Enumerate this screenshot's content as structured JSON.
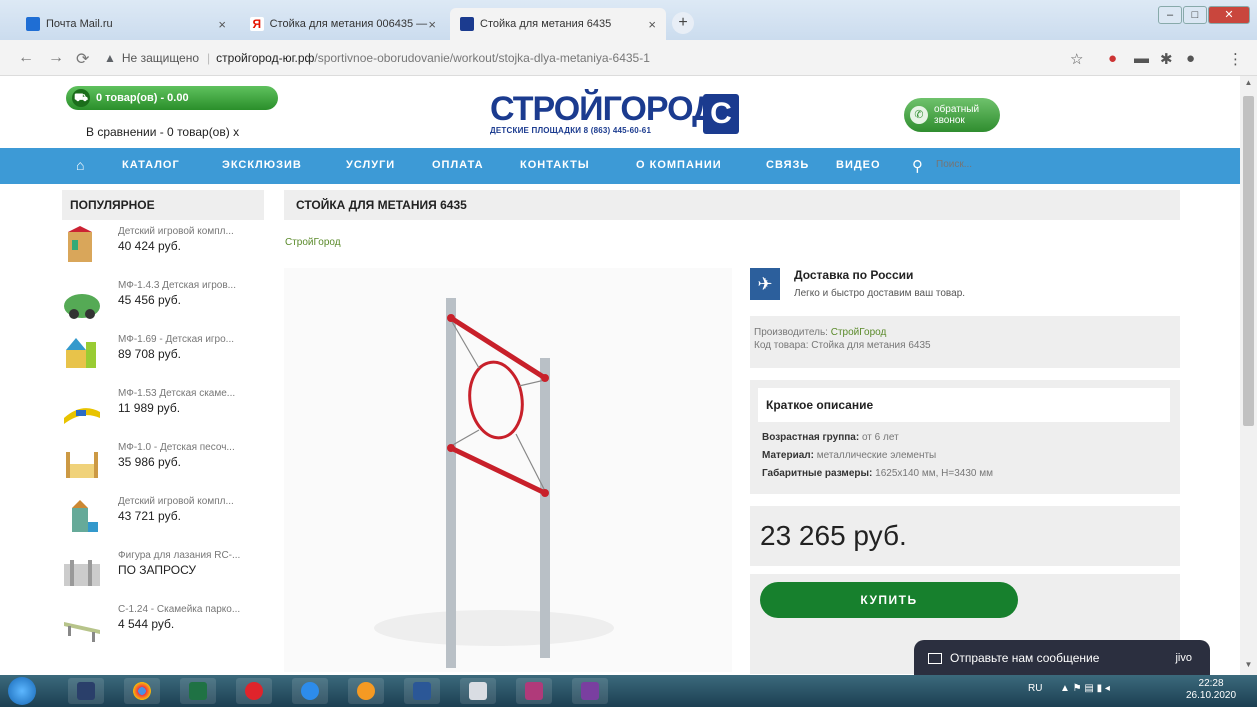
{
  "browser": {
    "tabs": [
      {
        "label": "Почта Mail.ru",
        "close": "×",
        "active": false
      },
      {
        "label": "Стойка для метания 006435 — :",
        "close": "×",
        "active": false
      },
      {
        "label": "Стойка для метания 6435",
        "close": "×",
        "active": true
      }
    ],
    "new_tab": "+",
    "security_label": "Не защищено",
    "url_host": "стройгород-юг.рф",
    "url_path": "/sportivnoe-oborudovanie/workout/stojka-dlya-metaniya-6435-1"
  },
  "header": {
    "cart_label": "0 товар(ов) - 0.00",
    "compare_label": "В сравнении - 0 товар(ов) x",
    "logo_text": "СТРОЙГОРОД",
    "logo_sub": "ДЕТСКИЕ ПЛОЩАДКИ 8 (863) 445-60-61",
    "callback_label_1": "обратный",
    "callback_label_2": "звонок"
  },
  "menu": {
    "items": [
      "КАТАЛОГ",
      "ЭКСКЛЮЗИВ",
      "УСЛУГИ",
      "ОПЛАТА",
      "КОНТАКТЫ",
      "О КОМПАНИИ",
      "СВЯЗЬ",
      "ВИДЕО"
    ],
    "search_placeholder": "Поиск..."
  },
  "sidebar": {
    "title": "ПОПУЛЯРНОЕ",
    "items": [
      {
        "name": "Детский игровой компл...",
        "price": "40 424 руб."
      },
      {
        "name": "МФ-1.4.3 Детская игров...",
        "price": "45 456 руб."
      },
      {
        "name": "МФ-1.69 - Детская игро...",
        "price": "89 708 руб."
      },
      {
        "name": "МФ-1.53 Детская скаме...",
        "price": "11 989 руб."
      },
      {
        "name": "МФ-1.0 - Детская песоч...",
        "price": "35 986 руб."
      },
      {
        "name": "Детский игровой компл...",
        "price": "43 721 руб."
      },
      {
        "name": "Фигура для лазания RC-...",
        "price": "ПО ЗАПРОСУ"
      },
      {
        "name": "С-1.24 - Скамейка парко...",
        "price": "4 544 руб."
      }
    ]
  },
  "product": {
    "title": "СТОЙКА ДЛЯ МЕТАНИЯ 6435",
    "breadcrumb": "СтройГород",
    "delivery_title": "Доставка по России",
    "delivery_text": "Легко и быстро доставим ваш товар.",
    "manufacturer_label": "Производитель:",
    "manufacturer_value": "СтройГород",
    "code_label": "Код товара:",
    "code_value": "Стойка для метания 6435",
    "desc_title": "Краткое описание",
    "age_label": "Возрастная группа:",
    "age_value": "от 6 лет",
    "material_label": "Материал:",
    "material_value": "металлические элементы",
    "size_label": "Габаритные размеры:",
    "size_value": "1625х140 мм, Н=3430 мм",
    "price": "23 265 руб.",
    "buy_label": "КУПИТЬ"
  },
  "chat": {
    "label": "Отправьте нам сообщение",
    "brand": "jivo"
  },
  "taskbar": {
    "lang": "RU",
    "time": "22:28",
    "date": "26.10.2020"
  },
  "colors": {
    "menu_bg": "#3d9ad6",
    "logo_blue": "#1b3b8f",
    "buy_green": "#17802d",
    "link_green": "#5a8a2a"
  }
}
